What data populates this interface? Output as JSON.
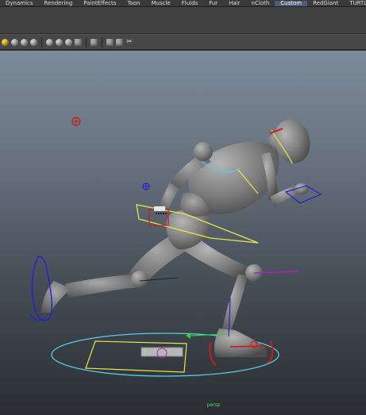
{
  "menubar": {
    "items": [
      {
        "label": "Dynamics",
        "active": false
      },
      {
        "label": "Rendering",
        "active": false
      },
      {
        "label": "PaintEffects",
        "active": false
      },
      {
        "label": "Toon",
        "active": false
      },
      {
        "label": "Muscle",
        "active": false
      },
      {
        "label": "Fluids",
        "active": false
      },
      {
        "label": "Fur",
        "active": false
      },
      {
        "label": "Hair",
        "active": false
      },
      {
        "label": "nCloth",
        "active": false
      },
      {
        "label": "Custom",
        "active": true
      },
      {
        "label": "RedGiant",
        "active": false
      },
      {
        "label": "TURTLE",
        "active": false
      }
    ]
  },
  "toolbar": {
    "tools": [
      {
        "icon": "sphere-yellow-icon"
      },
      {
        "icon": "sphere-icon"
      },
      {
        "icon": "sphere-icon"
      },
      {
        "icon": "sphere-icon"
      },
      {
        "icon": "separator"
      },
      {
        "icon": "light-icon"
      },
      {
        "icon": "sphere-icon"
      },
      {
        "icon": "sphere-icon"
      },
      {
        "icon": "texture-icon"
      },
      {
        "icon": "separator"
      },
      {
        "icon": "render-icon"
      },
      {
        "icon": "separator"
      },
      {
        "icon": "cube-icon"
      },
      {
        "icon": "cube-icon"
      },
      {
        "icon": "scissors-icon"
      }
    ]
  },
  "colors": {
    "accent": "#4f5d78",
    "rig_yellow": "#e6e64a",
    "rig_blue": "#2222cc",
    "rig_red": "#d01818",
    "rig_cyan": "#5ec8e0",
    "rig_green": "#2ed33f",
    "rig_magenta": "#b020c0"
  },
  "status": {
    "text": "persp"
  }
}
